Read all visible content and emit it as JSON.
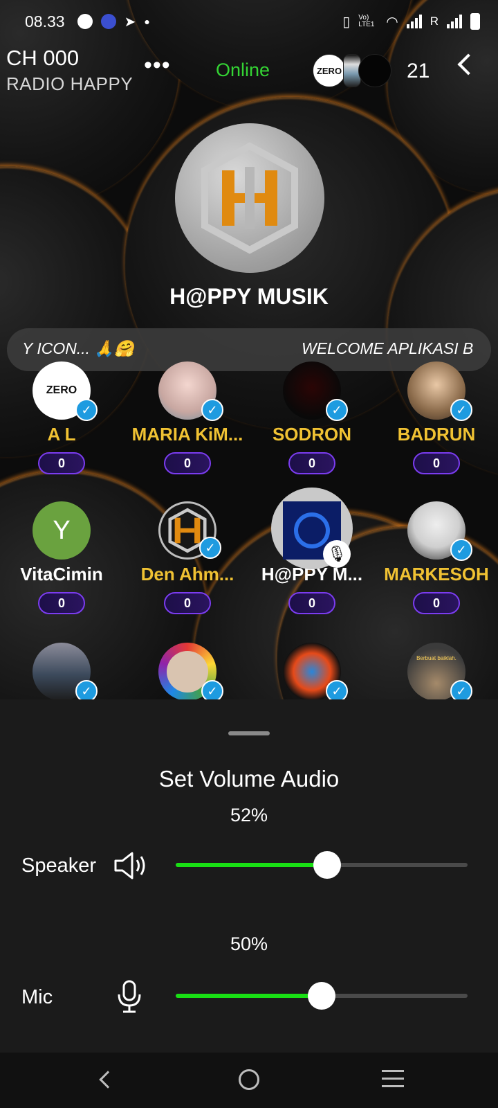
{
  "status_bar": {
    "time": "08.33",
    "signal_label": "R",
    "lte_label": "Vo) LTE1"
  },
  "header": {
    "channel": "CH 000",
    "room_subtitle": "RADIO HAPPY",
    "more_label": "•••",
    "status": "Online",
    "status_color": "#34d434",
    "first_avatar_text": "ZERO",
    "listener_count": "21"
  },
  "room": {
    "title": "H@PPY MUSIK"
  },
  "marquee": {
    "left_text": "Y ICON... 🙏🤗",
    "right_text": "WELCOME APLIKASI B"
  },
  "seats": [
    {
      "name": "A  L",
      "score": "0",
      "avatar_text": "ZERO"
    },
    {
      "name": "MARIA KiM...",
      "score": "0"
    },
    {
      "name": "SODRON",
      "score": "0"
    },
    {
      "name": "BADRUN",
      "score": "0"
    },
    {
      "name": "VitaCimin",
      "score": "0",
      "avatar_text": "Y"
    },
    {
      "name": "Den Ahm...",
      "score": "0"
    },
    {
      "name": "H@PPY M...",
      "score": "0"
    },
    {
      "name": "MARKESOH",
      "score": "0"
    },
    {
      "name": "",
      "score": ""
    },
    {
      "name": "",
      "score": ""
    },
    {
      "name": "",
      "score": ""
    },
    {
      "name": "",
      "score": "",
      "avatar_text": "Berbuat baiklah."
    }
  ],
  "volume_sheet": {
    "title": "Set Volume Audio",
    "speaker_label": "Speaker",
    "speaker_percent": "52%",
    "speaker_value": 0.52,
    "mic_label": "Mic",
    "mic_percent": "50%",
    "mic_value": 0.5,
    "track_color": "#19e014"
  }
}
